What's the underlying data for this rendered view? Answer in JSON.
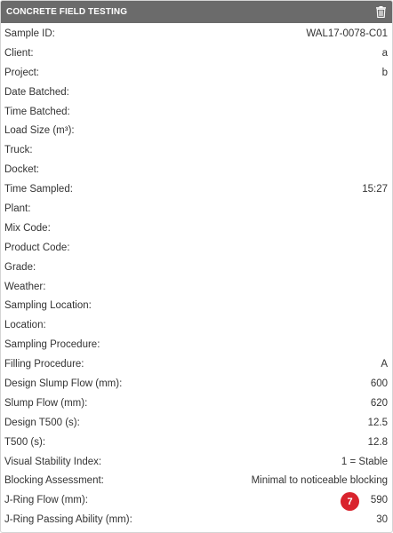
{
  "header": {
    "title": "CONCRETE FIELD TESTING",
    "delete_icon": "trash-icon"
  },
  "fields": [
    {
      "label": "Sample ID:",
      "value": "WAL17-0078-C01"
    },
    {
      "label": "Client:",
      "value": "a"
    },
    {
      "label": "Project:",
      "value": "b"
    },
    {
      "label": "Date Batched:",
      "value": ""
    },
    {
      "label": "Time Batched:",
      "value": ""
    },
    {
      "label": "Load Size (m³):",
      "value": ""
    },
    {
      "label": "Truck:",
      "value": ""
    },
    {
      "label": "Docket:",
      "value": ""
    },
    {
      "label": "Time Sampled:",
      "value": "15:27"
    },
    {
      "label": "Plant:",
      "value": ""
    },
    {
      "label": "Mix Code:",
      "value": ""
    },
    {
      "label": "Product Code:",
      "value": ""
    },
    {
      "label": "Grade:",
      "value": ""
    },
    {
      "label": "Weather:",
      "value": ""
    },
    {
      "label": "Sampling Location:",
      "value": ""
    },
    {
      "label": "Location:",
      "value": ""
    },
    {
      "label": "Sampling Procedure:",
      "value": ""
    },
    {
      "label": "Filling Procedure:",
      "value": "A"
    },
    {
      "label": "Design Slump Flow (mm):",
      "value": "600"
    },
    {
      "label": "Slump Flow (mm):",
      "value": "620"
    },
    {
      "label": "Design T500 (s):",
      "value": "12.5"
    },
    {
      "label": "T500 (s):",
      "value": "12.8"
    },
    {
      "label": "Visual Stability Index:",
      "value": "1 = Stable"
    },
    {
      "label": "Blocking Assessment:",
      "value": "Minimal to noticeable blocking"
    },
    {
      "label": "J-Ring Flow (mm):",
      "value": "590"
    },
    {
      "label": "J-Ring Passing Ability (mm):",
      "value": "30"
    }
  ],
  "badge": {
    "value": "7",
    "color": "#d9232d"
  }
}
